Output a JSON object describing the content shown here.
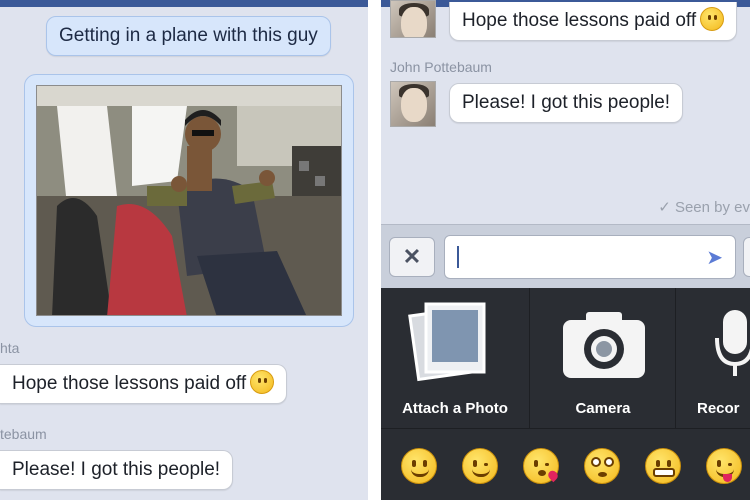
{
  "left_panel": {
    "outgoing_message": "Getting in a plane with this guy",
    "sender_1": "hta",
    "message_1": "Hope those lessons paid off",
    "sender_2": "tebaum",
    "message_2": "Please! I got this people!"
  },
  "right_panel": {
    "top_message": "Hope those lessons paid off",
    "sender": "John Pottebaum",
    "message": "Please! I got this people!",
    "seen_text": "✓ Seen by ev"
  },
  "composer": {
    "close_glyph": "✕",
    "send_glyph": "➤"
  },
  "tray": {
    "attach_label": "Attach a Photo",
    "camera_label": "Camera",
    "record_label": "Recor",
    "emojis": [
      "smile-icon",
      "wink-icon",
      "kiss-icon",
      "flushed-icon",
      "grin-icon",
      "tongue-wink-icon"
    ]
  },
  "colors": {
    "header_blue": "#3b5998",
    "outgoing_bubble": "#d7e6fb",
    "tray_dark": "#2a2d33"
  }
}
